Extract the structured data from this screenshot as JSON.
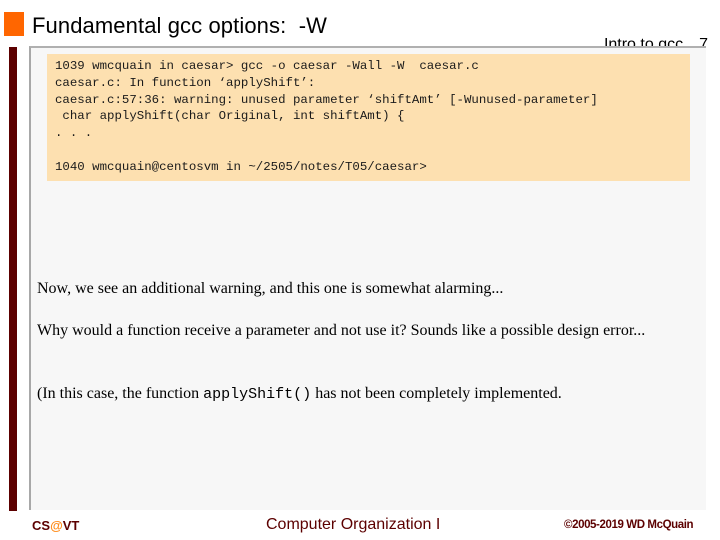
{
  "header": {
    "title": "Fundamental gcc options:  -W",
    "section": "Intro to gcc",
    "page_number": "7"
  },
  "terminal": {
    "lines": [
      "1039 wmcquain in caesar> gcc -o caesar -Wall -W  caesar.c",
      "caesar.c: In function ‘applyShift’:",
      "caesar.c:57:36: warning: unused parameter ‘shiftAmt’ [-Wunused-parameter]",
      " char applyShift(char Original, int shiftAmt) {",
      ". . .",
      "",
      "1040 wmcquain@centosvm in ~/2505/notes/T05/caesar>"
    ]
  },
  "body": {
    "paragraph1": "Now, we see an additional warning, and this one is somewhat alarming...",
    "paragraph2": "Why would a function receive a parameter and not use it?  Sounds like a possible design error...",
    "paragraph3_prefix": "(In this case, the function ",
    "paragraph3_code": "applyShift()",
    "paragraph3_suffix": " has not been completely implemented."
  },
  "footer": {
    "left_prefix": "CS",
    "left_at": "@",
    "left_suffix": "VT",
    "center": "Computer Organization I",
    "right": "©2005-2019 WD McQuain"
  },
  "colors": {
    "accent_orange": "#ff6600",
    "maroon": "#5c0000",
    "code_background": "#fde0b0",
    "panel_background": "#f7f7f7"
  }
}
